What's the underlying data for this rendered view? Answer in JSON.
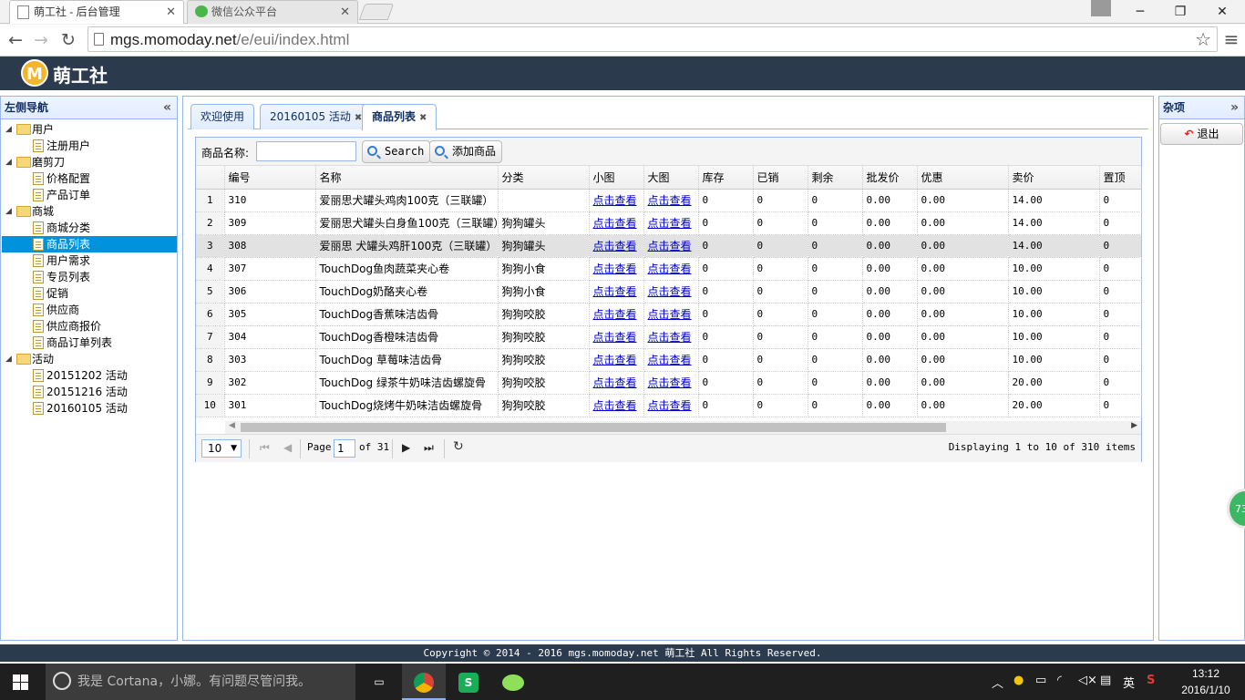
{
  "browser": {
    "tabs": [
      {
        "title": "萌工社 - 后台管理"
      },
      {
        "title": "微信公众平台"
      }
    ],
    "url_host": "mgs.momoday.net",
    "url_path": "/e/eui/index.html"
  },
  "app": {
    "logo_letter": "M",
    "brand": "萌工社"
  },
  "left_nav": {
    "title": "左侧导航",
    "collapse": "«",
    "tree": [
      {
        "label": "用户",
        "type": "folder"
      },
      {
        "label": "注册用户",
        "type": "file"
      },
      {
        "label": "磨剪刀",
        "type": "folder"
      },
      {
        "label": "价格配置",
        "type": "file"
      },
      {
        "label": "产品订单",
        "type": "file"
      },
      {
        "label": "商城",
        "type": "folder"
      },
      {
        "label": "商城分类",
        "type": "file"
      },
      {
        "label": "商品列表",
        "type": "file",
        "selected": true
      },
      {
        "label": "用户需求",
        "type": "file"
      },
      {
        "label": "专员列表",
        "type": "file"
      },
      {
        "label": "促销",
        "type": "file"
      },
      {
        "label": "供应商",
        "type": "file"
      },
      {
        "label": "供应商报价",
        "type": "file"
      },
      {
        "label": "商品订单列表",
        "type": "file"
      },
      {
        "label": "活动",
        "type": "folder"
      },
      {
        "label": "20151202 活动",
        "type": "file"
      },
      {
        "label": "20151216 活动",
        "type": "file"
      },
      {
        "label": "20160105 活动",
        "type": "file"
      }
    ]
  },
  "right_panel": {
    "title": "杂项",
    "collapse": "»",
    "logout": "退出"
  },
  "content_tabs": [
    {
      "label": "欢迎使用",
      "closable": false
    },
    {
      "label": "20160105 活动",
      "closable": true
    },
    {
      "label": "商品列表",
      "closable": true,
      "active": true
    }
  ],
  "grid": {
    "filter_label": "商品名称:",
    "search_button": "Search",
    "add_button": "添加商品",
    "columns": [
      "编号",
      "名称",
      "分类",
      "小图",
      "大图",
      "库存",
      "已销",
      "剩余",
      "批发价",
      "优惠",
      "卖价",
      "置顶"
    ],
    "rows": [
      {
        "n": "1",
        "id": "310",
        "name": "爱丽思犬罐头鸡肉100克（三联罐）",
        "cat": "",
        "small": "点击查看",
        "big": "点击查看",
        "stock": "0",
        "sold": "0",
        "left": "0",
        "wholesale": "0.00",
        "discount": "0.00",
        "price": "14.00",
        "top": "0"
      },
      {
        "n": "2",
        "id": "309",
        "name": "爱丽思犬罐头白身鱼100克（三联罐）",
        "cat": "狗狗罐头",
        "small": "点击查看",
        "big": "点击查看",
        "stock": "0",
        "sold": "0",
        "left": "0",
        "wholesale": "0.00",
        "discount": "0.00",
        "price": "14.00",
        "top": "0"
      },
      {
        "n": "3",
        "id": "308",
        "name": "爱丽思 犬罐头鸡肝100克（三联罐）",
        "cat": "狗狗罐头",
        "small": "点击查看",
        "big": "点击查看",
        "stock": "0",
        "sold": "0",
        "left": "0",
        "wholesale": "0.00",
        "discount": "0.00",
        "price": "14.00",
        "top": "0"
      },
      {
        "n": "4",
        "id": "307",
        "name": "TouchDog鱼肉蔬菜夹心卷",
        "cat": "狗狗小食",
        "small": "点击查看",
        "big": "点击查看",
        "stock": "0",
        "sold": "0",
        "left": "0",
        "wholesale": "0.00",
        "discount": "0.00",
        "price": "10.00",
        "top": "0"
      },
      {
        "n": "5",
        "id": "306",
        "name": "TouchDog奶酪夹心卷",
        "cat": "狗狗小食",
        "small": "点击查看",
        "big": "点击查看",
        "stock": "0",
        "sold": "0",
        "left": "0",
        "wholesale": "0.00",
        "discount": "0.00",
        "price": "10.00",
        "top": "0"
      },
      {
        "n": "6",
        "id": "305",
        "name": "TouchDog香蕉味洁齿骨",
        "cat": "狗狗咬胶",
        "small": "点击查看",
        "big": "点击查看",
        "stock": "0",
        "sold": "0",
        "left": "0",
        "wholesale": "0.00",
        "discount": "0.00",
        "price": "10.00",
        "top": "0"
      },
      {
        "n": "7",
        "id": "304",
        "name": "TouchDog香橙味洁齿骨",
        "cat": "狗狗咬胶",
        "small": "点击查看",
        "big": "点击查看",
        "stock": "0",
        "sold": "0",
        "left": "0",
        "wholesale": "0.00",
        "discount": "0.00",
        "price": "10.00",
        "top": "0"
      },
      {
        "n": "8",
        "id": "303",
        "name": "TouchDog 草莓味洁齿骨",
        "cat": "狗狗咬胶",
        "small": "点击查看",
        "big": "点击查看",
        "stock": "0",
        "sold": "0",
        "left": "0",
        "wholesale": "0.00",
        "discount": "0.00",
        "price": "10.00",
        "top": "0"
      },
      {
        "n": "9",
        "id": "302",
        "name": "TouchDog 绿茶牛奶味洁齿螺旋骨",
        "cat": "狗狗咬胶",
        "small": "点击查看",
        "big": "点击查看",
        "stock": "0",
        "sold": "0",
        "left": "0",
        "wholesale": "0.00",
        "discount": "0.00",
        "price": "20.00",
        "top": "0"
      },
      {
        "n": "10",
        "id": "301",
        "name": "TouchDog烧烤牛奶味洁齿螺旋骨",
        "cat": "狗狗咬胶",
        "small": "点击查看",
        "big": "点击查看",
        "stock": "0",
        "sold": "0",
        "left": "0",
        "wholesale": "0.00",
        "discount": "0.00",
        "price": "20.00",
        "top": "0"
      }
    ],
    "pager": {
      "page_size": "10",
      "page_label": "Page",
      "page": "1",
      "of_label": "of 31",
      "display": "Displaying 1 to 10 of 310 items"
    }
  },
  "footer": {
    "text": "Copyright © 2014 - 2016 mgs.momoday.net 萌工社 All Rights Reserved."
  },
  "floater": {
    "text": "73"
  },
  "taskbar": {
    "search_placeholder": "我是 Cortana，小娜。有问题尽管问我。",
    "ime": "英",
    "time": "13:12",
    "date": "2016/1/10"
  }
}
